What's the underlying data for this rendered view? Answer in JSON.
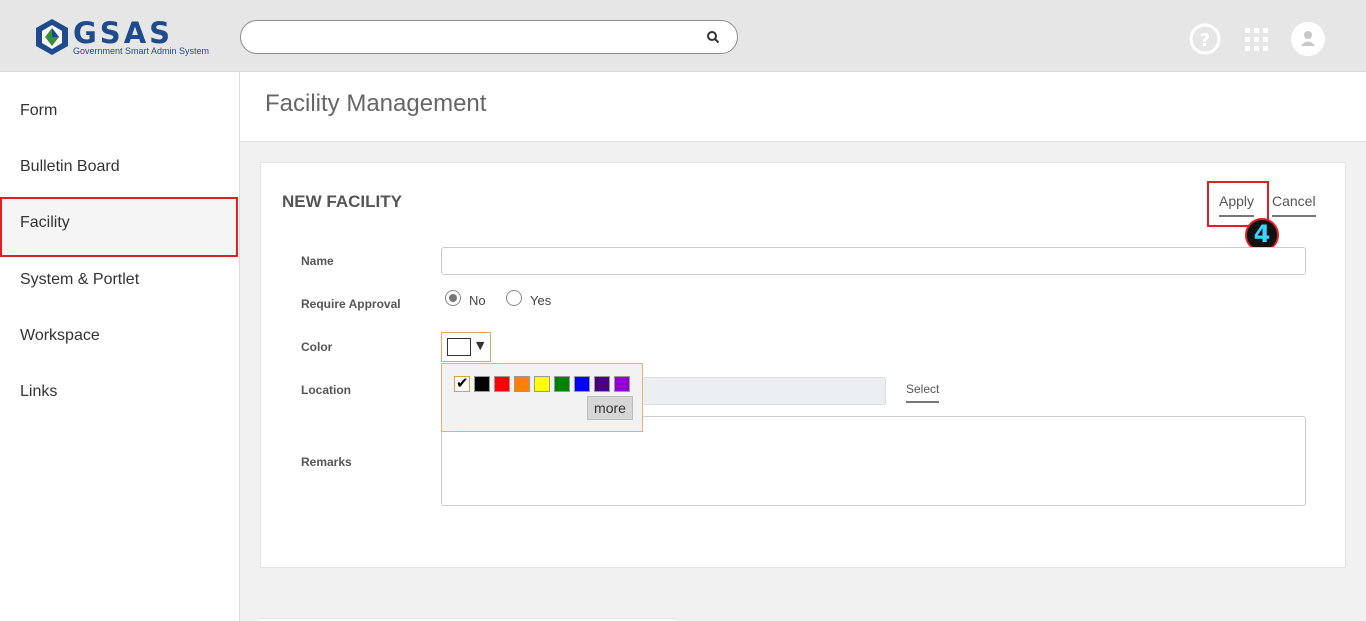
{
  "header": {
    "logo_text": "GSAS",
    "logo_subtitle": "Government Smart Admin System",
    "search_placeholder": "",
    "icons": [
      "search-icon",
      "help-icon",
      "apps-grid-icon",
      "user-avatar-icon"
    ]
  },
  "sidebar": {
    "items": [
      {
        "label": "Form"
      },
      {
        "label": "Bulletin Board"
      },
      {
        "label": "Facility"
      },
      {
        "label": "System & Portlet"
      },
      {
        "label": "Workspace"
      },
      {
        "label": "Links"
      }
    ],
    "active_index": 2
  },
  "page": {
    "title": "Facility Management"
  },
  "form": {
    "title": "NEW FACILITY",
    "apply_label": "Apply",
    "cancel_label": "Cancel",
    "step_badge": "4",
    "name_label": "Name",
    "name_value": "",
    "approval_label": "Require Approval",
    "approval_options": [
      "No",
      "Yes"
    ],
    "approval_selected": "No",
    "color_label": "Color",
    "location_label": "Location",
    "location_value": "",
    "select_label": "Select",
    "remarks_label": "Remarks",
    "remarks_value": ""
  },
  "palette": {
    "colors": [
      "#ffffff",
      "#000000",
      "#ff0000",
      "#ff8000",
      "#ffff00",
      "#008000",
      "#0000ff",
      "#4b0082",
      "#9400d3"
    ],
    "selected_index": 0,
    "more_label": "more"
  },
  "colors": {
    "accent_highlight": "#e02020",
    "logo_blue": "#1f4b8c",
    "logo_green": "#3a8f3a"
  }
}
